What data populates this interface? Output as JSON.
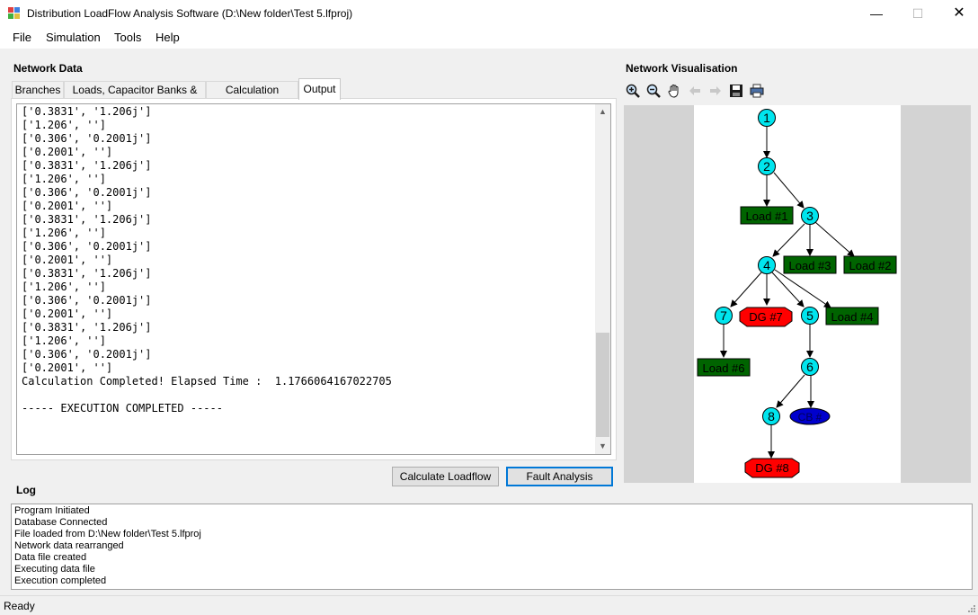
{
  "window": {
    "title": "Distribution LoadFlow Analysis Software (D:\\New folder\\Test 5.lfproj)",
    "controls": [
      "minimize-icon",
      "maximize-icon",
      "close-icon"
    ]
  },
  "menu": {
    "items": [
      {
        "label": "File"
      },
      {
        "label": "Simulation"
      },
      {
        "label": "Tools"
      },
      {
        "label": "Help"
      }
    ]
  },
  "network_data": {
    "label": "Network Data",
    "tabs": [
      {
        "label": "Branches"
      },
      {
        "label": "Loads, Capacitor Banks & DGs"
      },
      {
        "label": "Calculation Settings"
      },
      {
        "label": "Output",
        "active": true
      }
    ],
    "output_lines": [
      "['0.3831', '1.206j']",
      "['1.206', '']",
      "['0.306', '0.2001j']",
      "['0.2001', '']",
      "['0.3831', '1.206j']",
      "['1.206', '']",
      "['0.306', '0.2001j']",
      "['0.2001', '']",
      "['0.3831', '1.206j']",
      "['1.206', '']",
      "['0.306', '0.2001j']",
      "['0.2001', '']",
      "['0.3831', '1.206j']",
      "['1.206', '']",
      "['0.306', '0.2001j']",
      "['0.2001', '']",
      "['0.3831', '1.206j']",
      "['1.206', '']",
      "['0.306', '0.2001j']",
      "['0.2001', '']",
      "Calculation Completed! Elapsed Time :  1.1766064167022705",
      "",
      "----- EXECUTION COMPLETED -----"
    ]
  },
  "buttons": {
    "calculate": "Calculate Loadflow",
    "fault": "Fault Analysis"
  },
  "visualisation": {
    "label": "Network Visualisation",
    "toolbar": [
      "zoom-in-icon",
      "zoom-out-icon",
      "pan-hand-icon",
      "back-arrow-icon",
      "forward-arrow-icon",
      "save-icon",
      "print-icon"
    ],
    "colors": {
      "bus": "#00e5ee",
      "load": "#006400",
      "dg": "#ff0000",
      "cap": "#0000cd"
    },
    "buses": [
      "1",
      "2",
      "3",
      "4",
      "5",
      "6",
      "7",
      "8"
    ],
    "loads": [
      "Load #1",
      "Load #3",
      "Load #2",
      "Load #4",
      "Load #6"
    ],
    "dgs": [
      "DG #7",
      "DG #8"
    ],
    "caps": [
      "CB #"
    ]
  },
  "log": {
    "label": "Log",
    "lines": [
      "Program Initiated",
      "Database Connected",
      "File loaded from D:\\New folder\\Test 5.lfproj",
      "Network data rearranged",
      "Data file created",
      "Executing data file",
      "Execution completed"
    ]
  },
  "status": {
    "text": "Ready"
  }
}
